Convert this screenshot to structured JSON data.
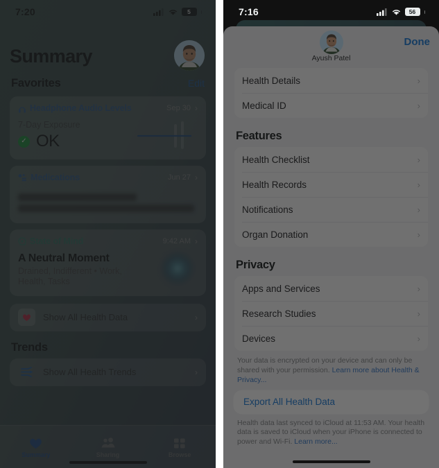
{
  "left": {
    "status": {
      "time": "7:20",
      "battery": "5",
      "cellular_icon": "cellular-bars-icon",
      "wifi_icon": "wifi-icon"
    },
    "title": "Summary",
    "avatar_name": "avatar",
    "favorites": {
      "heading": "Favorites",
      "edit": "Edit"
    },
    "cards": [
      {
        "name": "Headphone Audio Levels",
        "icon": "headphone-icon",
        "date": "Sep 30",
        "subtitle": "7-Day Exposure",
        "status": "OK",
        "check_icon": "check-circle-icon"
      },
      {
        "name": "Medications",
        "icon": "pills-icon",
        "date": "Jun 27",
        "blurred_text_line1": "creatinine monohydrate,",
        "blurred_text_line2": "Homeopathic Pills, and Deflazacort"
      },
      {
        "name": "State of Mind",
        "icon": "head-profile-icon",
        "date": "9:42 AM",
        "mood_title": "A Neutral Moment",
        "mood_sub": "Drained, Indifferent • Work, Health, Tasks"
      }
    ],
    "show_all_health_data": {
      "label": "Show All Health Data",
      "icon": "heart-icon"
    },
    "trends": {
      "heading": "Trends",
      "label": "Show All Health Trends",
      "icon": "trends-arrows-icon"
    },
    "tabs": [
      {
        "label": "Summary",
        "icon": "heart-filled-icon",
        "selected": true
      },
      {
        "label": "Sharing",
        "icon": "people-icon",
        "selected": false
      },
      {
        "label": "Browse",
        "icon": "grid-icon",
        "selected": false
      }
    ]
  },
  "right": {
    "status": {
      "time": "7:16",
      "battery": "56",
      "cellular_icon": "cellular-bars-icon",
      "wifi_icon": "wifi-icon"
    },
    "sheet": {
      "profile_name": "Ayush Patel",
      "done_label": "Done",
      "top_group": [
        {
          "label": "Health Details"
        },
        {
          "label": "Medical ID"
        }
      ],
      "features_heading": "Features",
      "features": [
        {
          "label": "Health Checklist"
        },
        {
          "label": "Health Records"
        },
        {
          "label": "Notifications"
        },
        {
          "label": "Organ Donation"
        }
      ],
      "privacy_heading": "Privacy",
      "privacy": [
        {
          "label": "Apps and Services"
        },
        {
          "label": "Research Studies"
        },
        {
          "label": "Devices"
        }
      ],
      "privacy_note": "Your data is encrypted on your device and can only be shared with your permission.",
      "privacy_link": "Learn more about Health & Privacy...",
      "export_label": "Export All Health Data",
      "sync_note": "Health data last synced to iCloud at 11:53 AM. Your health data is saved to iCloud when your iPhone is connected to power and Wi-Fi.",
      "sync_link": "Learn more..."
    }
  },
  "colors": {
    "accent_blue": "#0b72d6",
    "link_blue": "#2a6fc4",
    "teal": "#2f7a6b",
    "green_ok": "#149b3f",
    "sheet_bg": "#f0f0f2"
  }
}
